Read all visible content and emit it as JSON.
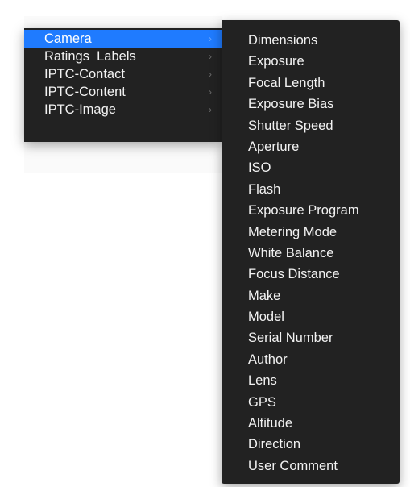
{
  "menu": {
    "items": [
      {
        "label": "Camera",
        "chevron": "›",
        "selected": true
      },
      {
        "label": "Ratings  Labels",
        "chevron": "›",
        "selected": false
      },
      {
        "label": "IPTC-Contact",
        "chevron": "›",
        "selected": false
      },
      {
        "label": "IPTC-Content",
        "chevron": "›",
        "selected": false
      },
      {
        "label": "IPTC-Image",
        "chevron": "›",
        "selected": false
      }
    ]
  },
  "submenu": {
    "items": [
      "Dimensions",
      "Exposure",
      "Focal Length",
      "Exposure Bias",
      "Shutter Speed",
      "Aperture",
      "ISO",
      "Flash",
      "Exposure Program",
      "Metering Mode",
      "White Balance",
      "Focus Distance",
      "Make",
      "Model",
      "Serial Number",
      "Author",
      "Lens",
      "GPS",
      "Altitude",
      "Direction",
      "User Comment"
    ]
  },
  "colors": {
    "menu_background": "#222222",
    "selection": "#1f7bff",
    "text": "#f2f2f2",
    "chevron": "#6a6a6a"
  },
  "icons": {
    "chevron": "chevron-right-icon"
  }
}
